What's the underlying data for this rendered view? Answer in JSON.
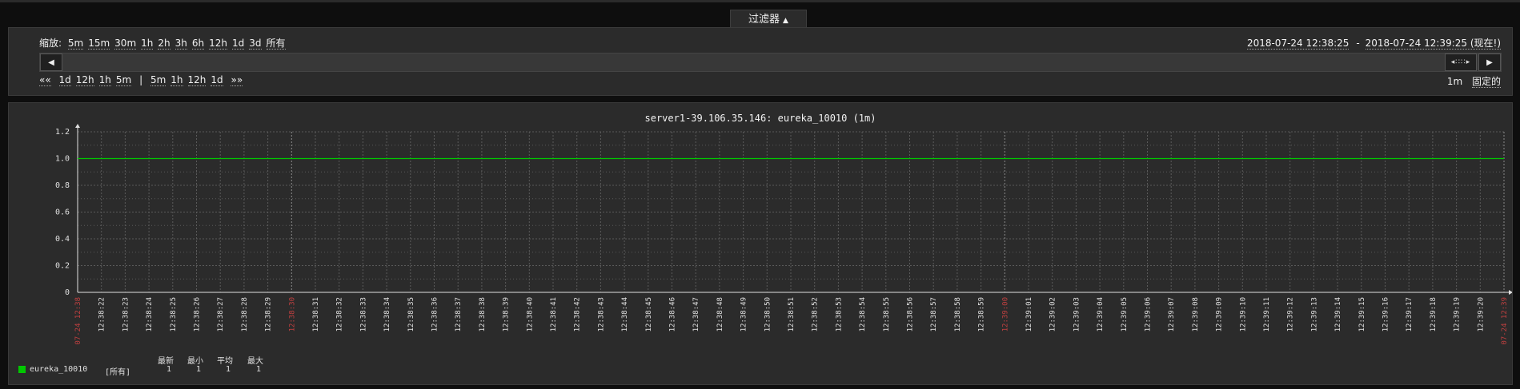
{
  "filter": {
    "label": "过滤器",
    "arrow": "▲"
  },
  "zoom": {
    "label": "缩放:",
    "options": [
      "5m",
      "15m",
      "30m",
      "1h",
      "2h",
      "3h",
      "6h",
      "12h",
      "1d",
      "3d",
      "所有"
    ]
  },
  "period_range": {
    "from": "2018-07-24 12:38:25",
    "separator": "-",
    "to": "2018-07-24 12:39:25 (现在!)"
  },
  "nav": {
    "back_all": "««",
    "back": [
      "1d",
      "12h",
      "1h",
      "5m"
    ],
    "divider": "|",
    "forward": [
      "5m",
      "1h",
      "12h",
      "1d"
    ],
    "forward_all": "»»",
    "period": "1m",
    "fixed": "固定的"
  },
  "scrollbar": {
    "left_icon": "triangle-left-icon",
    "right_icon": "triangle-right-icon",
    "handle_label": "◂∷∷▸"
  },
  "graph": {
    "title": "server1-39.106.35.146: eureka_10010 (1m)"
  },
  "chart_data": {
    "type": "line",
    "title": "server1-39.106.35.146: eureka_10010 (1m)",
    "ylim": [
      0,
      1.2
    ],
    "yticks": [
      "1.2",
      "1.0",
      "0.8",
      "0.6",
      "0.4",
      "0.2",
      "0"
    ],
    "xticks": [
      {
        "label": "07-24 12:38",
        "highlight": true
      },
      {
        "label": "12:38:22"
      },
      {
        "label": "12:38:23"
      },
      {
        "label": "12:38:24"
      },
      {
        "label": "12:38:25"
      },
      {
        "label": "12:38:26"
      },
      {
        "label": "12:38:27"
      },
      {
        "label": "12:38:28"
      },
      {
        "label": "12:38:29"
      },
      {
        "label": "12:38:30",
        "highlight": true
      },
      {
        "label": "12:38:31"
      },
      {
        "label": "12:38:32"
      },
      {
        "label": "12:38:33"
      },
      {
        "label": "12:38:34"
      },
      {
        "label": "12:38:35"
      },
      {
        "label": "12:38:36"
      },
      {
        "label": "12:38:37"
      },
      {
        "label": "12:38:38"
      },
      {
        "label": "12:38:39"
      },
      {
        "label": "12:38:40"
      },
      {
        "label": "12:38:41"
      },
      {
        "label": "12:38:42"
      },
      {
        "label": "12:38:43"
      },
      {
        "label": "12:38:44"
      },
      {
        "label": "12:38:45"
      },
      {
        "label": "12:38:46"
      },
      {
        "label": "12:38:47"
      },
      {
        "label": "12:38:48"
      },
      {
        "label": "12:38:49"
      },
      {
        "label": "12:38:50"
      },
      {
        "label": "12:38:51"
      },
      {
        "label": "12:38:52"
      },
      {
        "label": "12:38:53"
      },
      {
        "label": "12:38:54"
      },
      {
        "label": "12:38:55"
      },
      {
        "label": "12:38:56"
      },
      {
        "label": "12:38:57"
      },
      {
        "label": "12:38:58"
      },
      {
        "label": "12:38:59"
      },
      {
        "label": "12:39:00",
        "highlight": true
      },
      {
        "label": "12:39:01"
      },
      {
        "label": "12:39:02"
      },
      {
        "label": "12:39:03"
      },
      {
        "label": "12:39:04"
      },
      {
        "label": "12:39:05"
      },
      {
        "label": "12:39:06"
      },
      {
        "label": "12:39:07"
      },
      {
        "label": "12:39:08"
      },
      {
        "label": "12:39:09"
      },
      {
        "label": "12:39:10"
      },
      {
        "label": "12:39:11"
      },
      {
        "label": "12:39:12"
      },
      {
        "label": "12:39:13"
      },
      {
        "label": "12:39:14"
      },
      {
        "label": "12:39:15"
      },
      {
        "label": "12:39:16"
      },
      {
        "label": "12:39:17"
      },
      {
        "label": "12:39:18"
      },
      {
        "label": "12:39:19"
      },
      {
        "label": "12:39:20"
      },
      {
        "label": "07-24 12:39",
        "highlight": true
      }
    ],
    "series": [
      {
        "name": "eureka_10010",
        "color": "#00c800",
        "values": [
          1,
          1
        ]
      }
    ],
    "grid": true,
    "colors": {
      "grid": "#5a5a5a",
      "axis": "#e0e0e0",
      "highlight_tick": "#c04040"
    }
  },
  "legend": {
    "headers": [
      "最新",
      "最小",
      "平均",
      "最大"
    ],
    "rows": [
      {
        "name": "eureka_10010",
        "scope": "[所有]",
        "last": "1",
        "min": "1",
        "avg": "1",
        "max": "1",
        "color": "#00c800"
      }
    ]
  }
}
